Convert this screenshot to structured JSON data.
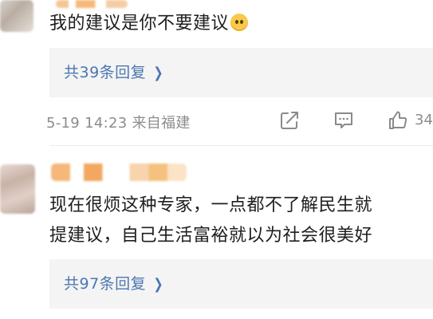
{
  "comments": [
    {
      "text": "我的建议是你不要建议",
      "emoji_icon": "pleading-face-emoji",
      "reply_link": "共39条回复",
      "meta": "5-19 14:23 来自福建",
      "like_count": "34"
    },
    {
      "lines": [
        "现在很烦这种专家，一点都不了解民生就",
        "提建议，自己生活富裕就以为社会很美好"
      ],
      "reply_link": "共97条回复"
    }
  ],
  "icons": [
    "share-icon",
    "comment-icon",
    "like-icon",
    "chevron-right-icon"
  ],
  "colors": {
    "link": "#4b77b1",
    "meta": "#8c8c8c",
    "reply_bg": "#f4f4f4"
  }
}
